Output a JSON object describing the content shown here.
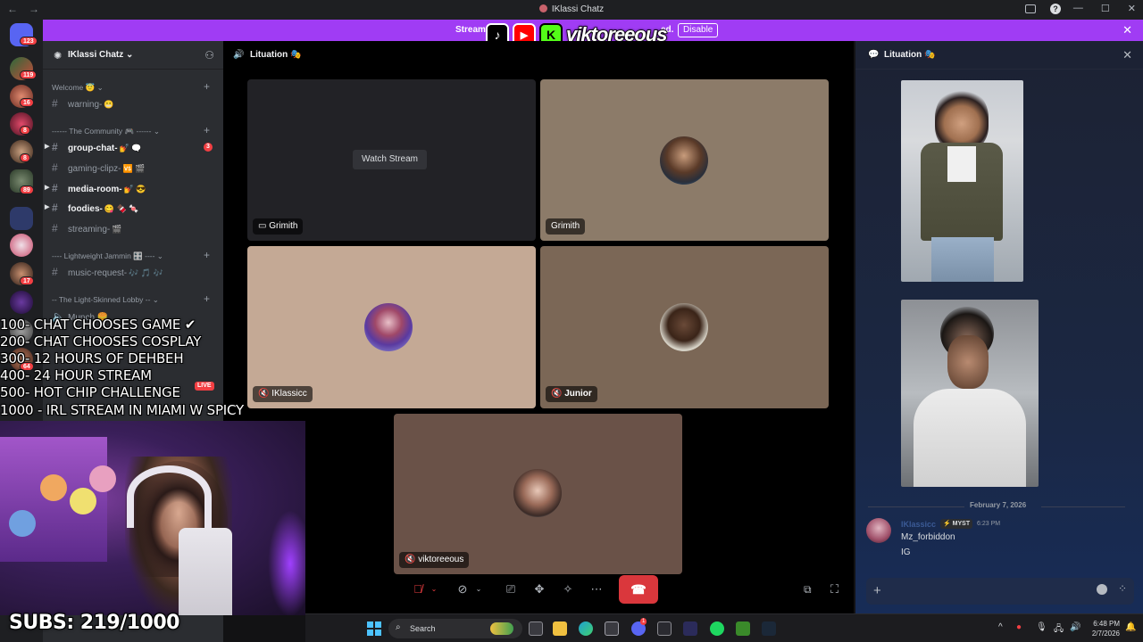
{
  "window": {
    "title": "IKlassi Chatz"
  },
  "banner": {
    "text_start": "Streamer",
    "text_end": "ed.",
    "disable_label": "Disable"
  },
  "social_overlay": {
    "handle": "viktoreeous"
  },
  "guilds": {
    "badges": [
      "123",
      "119",
      "16",
      "8",
      "8",
      "89",
      "17",
      "64"
    ]
  },
  "sidebar": {
    "server_name": "IKlassi Chatz",
    "categories": [
      {
        "label": "Welcome 😇"
      },
      {
        "label": "------ The Community 🎮 ------"
      },
      {
        "label": "---- Lightweight Jammin 🎛️ ----"
      },
      {
        "label": "-- The Light-Skinned Lobby --"
      }
    ],
    "channels": [
      {
        "label": "warning-",
        "emoji": "😬"
      },
      {
        "label": "group-chat-",
        "emoji": "💅 🗨️",
        "unread_badge": "3"
      },
      {
        "label": "gaming-clipz-",
        "emoji": "🆚 🎬"
      },
      {
        "label": "media-room-",
        "emoji": "💅 😎"
      },
      {
        "label": "foodies-",
        "emoji": "😋 🍫 🍬"
      },
      {
        "label": "streaming-",
        "emoji": "🎬"
      },
      {
        "label": "music-request-",
        "emoji": "🎶 🎵 🎶"
      }
    ],
    "partial_channel": "Munch 🍔",
    "live_badge": "LIVE"
  },
  "call": {
    "channel_name": "Lituation 🎭",
    "watch_stream_label": "Watch Stream",
    "tiles": [
      {
        "name": "Grimith"
      },
      {
        "name": "Grimith"
      },
      {
        "name": "IKlassicc"
      },
      {
        "name": "Junior"
      },
      {
        "name": "viktoreeous"
      }
    ]
  },
  "chat": {
    "channel_name": "Lituation 🎭",
    "date_divider": "February 7, 2026",
    "message": {
      "author": "IKlassicc",
      "tag": "⚡ MYST",
      "time": "6:23 PM",
      "lines": [
        "Mz_forbiddon",
        "IG"
      ]
    }
  },
  "overlay_goals": [
    "100- CHAT CHOOSES GAME ✔",
    "200- CHAT CHOOSES COSPLAY",
    "300- 12 HOURS OF DEHBEH",
    "400- 24 HOUR STREAM",
    "500- HOT CHIP CHALLENGE",
    "1000 - IRL STREAM IN MIAMI W SPICY"
  ],
  "subs_counter": "SUBS: 219/1000",
  "taskbar": {
    "search_label": "Search",
    "discord_badge": "1",
    "time": "6:48 PM",
    "date": "2/7/2026"
  },
  "colors": {
    "banner": "#a03cf4",
    "hangup": "#da373c",
    "unread": "#f23f43",
    "kick": "#53fc18"
  }
}
